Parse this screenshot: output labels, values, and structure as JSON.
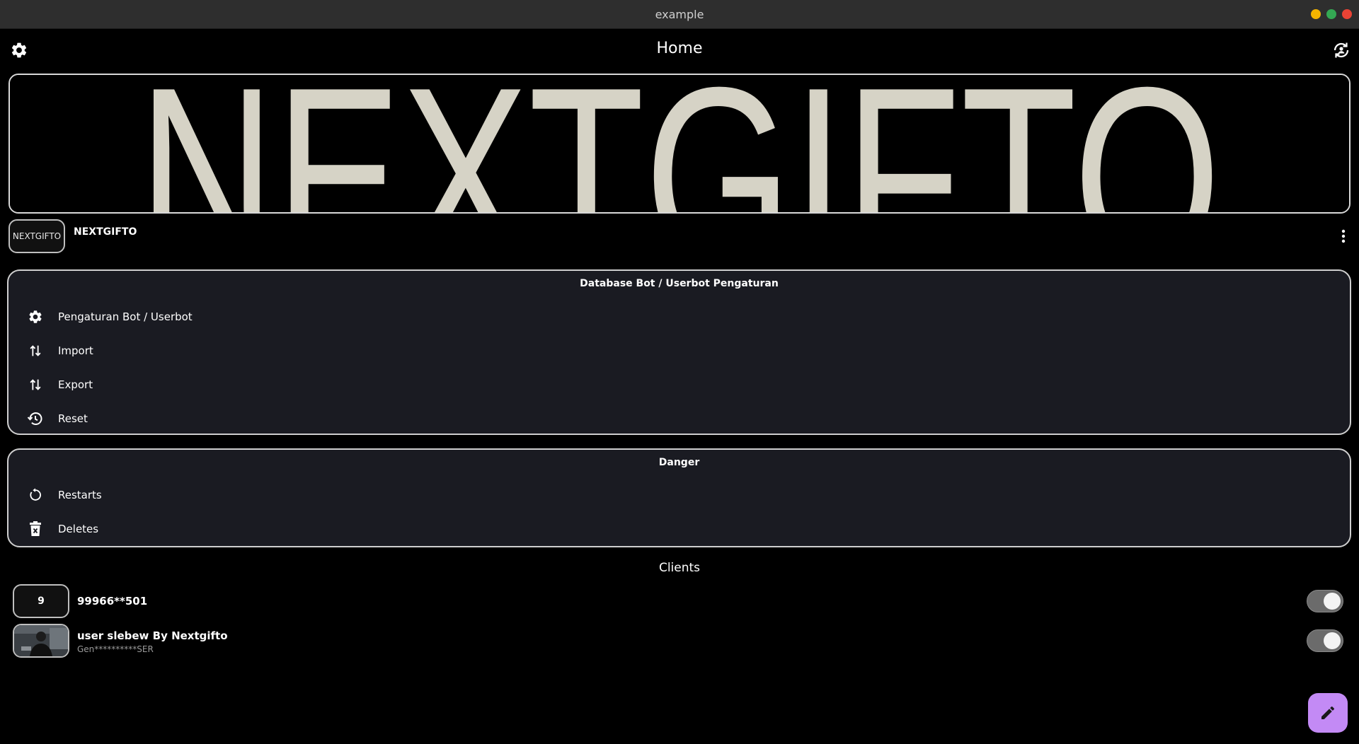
{
  "window": {
    "title": "example"
  },
  "appbar": {
    "title": "Home",
    "settings_icon": "gear-icon",
    "refresh_icon": "refresh-account-icon"
  },
  "banner": {
    "text": "NEXTGIFTO"
  },
  "profile": {
    "logo_text": "NEXTGIFTO",
    "name": "NEXTGIFTO"
  },
  "database_card": {
    "title": "Database Bot / Userbot Pengaturan",
    "items": [
      {
        "label": "Pengaturan Bot / Userbot",
        "icon": "gear-icon"
      },
      {
        "label": "Import",
        "icon": "swap-vertical-icon"
      },
      {
        "label": "Export",
        "icon": "swap-vertical-icon"
      },
      {
        "label": "Reset",
        "icon": "history-icon"
      }
    ]
  },
  "danger_card": {
    "title": "Danger",
    "items": [
      {
        "label": "Restarts",
        "icon": "restart-icon"
      },
      {
        "label": "Deletes",
        "icon": "trash-icon"
      }
    ]
  },
  "clients": {
    "title": "Clients",
    "items": [
      {
        "avatar_text": "9",
        "name": "99966**501",
        "subtitle": "",
        "enabled": true
      },
      {
        "avatar_text": "",
        "name": "user slebew By Nextgifto",
        "subtitle": "Gen**********SER",
        "enabled": true
      }
    ]
  },
  "colors": {
    "accent": "#c38af5",
    "card_bg": "#1a1b22",
    "banner_text": "#d6d3c6"
  }
}
